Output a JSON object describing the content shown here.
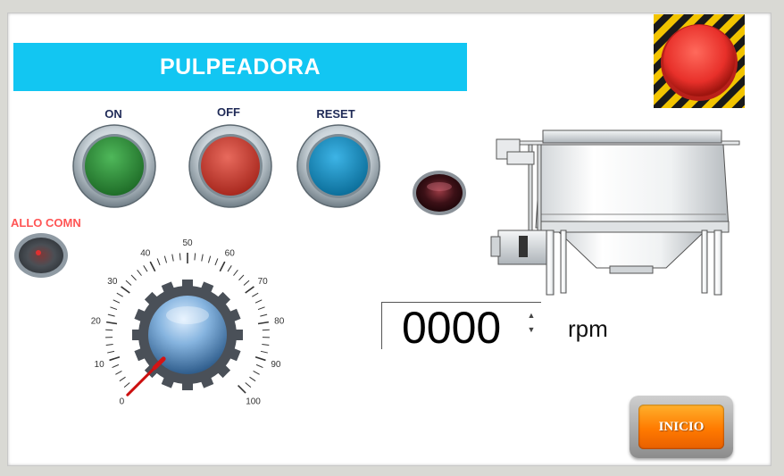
{
  "header": {
    "title": "PULPEADORA"
  },
  "buttons": {
    "on": {
      "label": "ON",
      "color": "#2e8b3a"
    },
    "off": {
      "label": "OFF",
      "color": "#d4473a"
    },
    "reset": {
      "label": "RESET",
      "color": "#1595c9"
    }
  },
  "alarm": {
    "label": "ALLO COMN"
  },
  "gauge": {
    "ticks": [
      "0",
      "10",
      "20",
      "30",
      "40",
      "50",
      "60",
      "70",
      "80",
      "90",
      "100"
    ],
    "value": 0
  },
  "speed": {
    "value": "0000",
    "unit": "rpm"
  },
  "inicio": {
    "label": "INICIO"
  },
  "colors": {
    "banner": "#12c6f2",
    "estop": "#e8302a",
    "inicio": "#ff7a00"
  },
  "icons": [
    "emergency-stop-icon",
    "pulper-machine-icon",
    "status-lamp-icon",
    "alarm-lamp-icon"
  ]
}
